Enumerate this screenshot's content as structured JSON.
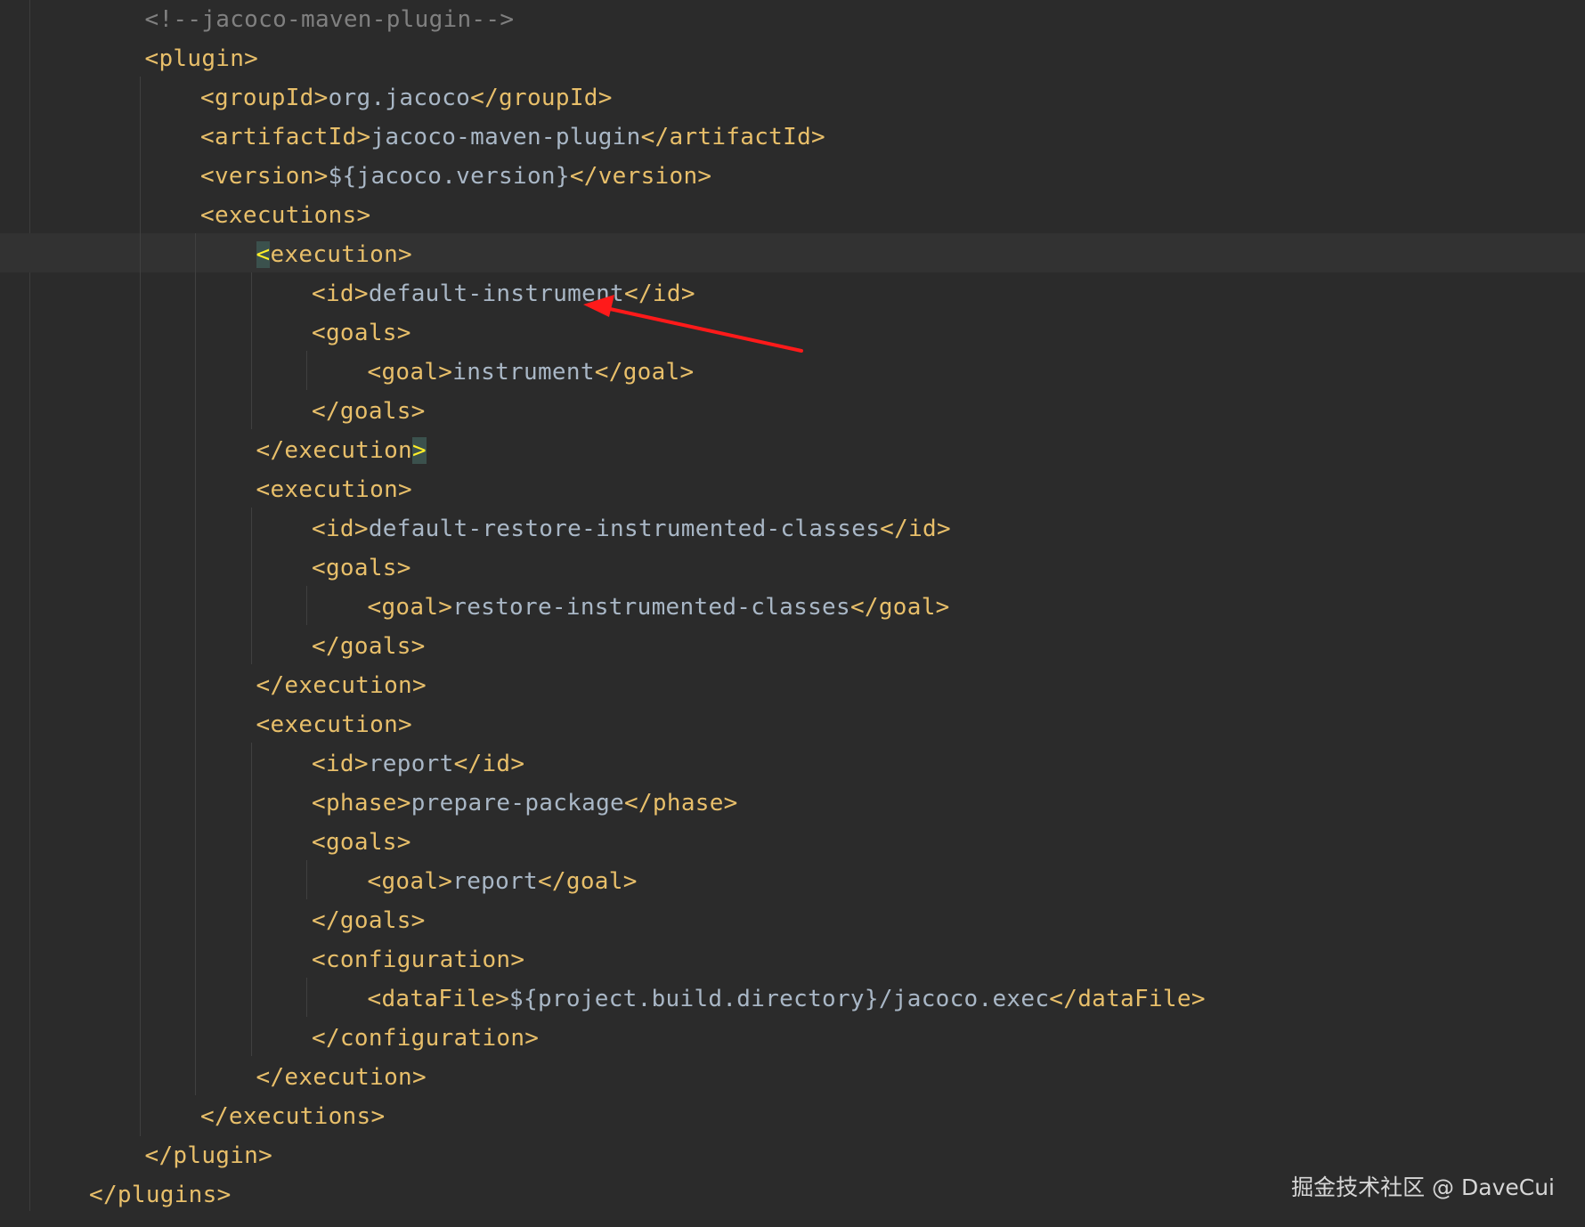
{
  "editor": {
    "lines": [
      {
        "indent": 3,
        "parts": [
          {
            "t": "<!--jacoco-maven-plugin-->",
            "c": "cmt"
          }
        ]
      },
      {
        "indent": 3,
        "parts": [
          {
            "t": "<plugin>",
            "c": "tag"
          }
        ]
      },
      {
        "indent": 4,
        "parts": [
          {
            "t": "<groupId>",
            "c": "tag"
          },
          {
            "t": "org.jacoco",
            "c": "txt"
          },
          {
            "t": "</groupId>",
            "c": "tag"
          }
        ]
      },
      {
        "indent": 4,
        "parts": [
          {
            "t": "<artifactId>",
            "c": "tag"
          },
          {
            "t": "jacoco-maven-plugin",
            "c": "txt"
          },
          {
            "t": "</artifactId>",
            "c": "tag"
          }
        ]
      },
      {
        "indent": 4,
        "parts": [
          {
            "t": "<version>",
            "c": "tag"
          },
          {
            "t": "${jacoco.version}",
            "c": "txt"
          },
          {
            "t": "</version>",
            "c": "tag"
          }
        ]
      },
      {
        "indent": 4,
        "parts": [
          {
            "t": "<executions>",
            "c": "tag"
          }
        ]
      },
      {
        "indent": 5,
        "current": true,
        "parts": [
          {
            "t": "<",
            "c": "bm"
          },
          {
            "t": "execution>",
            "c": "tag"
          }
        ]
      },
      {
        "indent": 6,
        "parts": [
          {
            "t": "<id>",
            "c": "tag"
          },
          {
            "t": "default-instrument",
            "c": "txt"
          },
          {
            "t": "</id>",
            "c": "tag"
          }
        ]
      },
      {
        "indent": 6,
        "parts": [
          {
            "t": "<goals>",
            "c": "tag"
          }
        ]
      },
      {
        "indent": 7,
        "parts": [
          {
            "t": "<goal>",
            "c": "tag"
          },
          {
            "t": "instrument",
            "c": "txt"
          },
          {
            "t": "</goal>",
            "c": "tag"
          }
        ]
      },
      {
        "indent": 6,
        "parts": [
          {
            "t": "</goals>",
            "c": "tag"
          }
        ]
      },
      {
        "indent": 5,
        "parts": [
          {
            "t": "</execution",
            "c": "tag"
          },
          {
            "t": ">",
            "c": "bm"
          }
        ]
      },
      {
        "indent": 5,
        "parts": [
          {
            "t": "<execution>",
            "c": "tag"
          }
        ]
      },
      {
        "indent": 6,
        "parts": [
          {
            "t": "<id>",
            "c": "tag"
          },
          {
            "t": "default-restore-instrumented-classes",
            "c": "txt"
          },
          {
            "t": "</id>",
            "c": "tag"
          }
        ]
      },
      {
        "indent": 6,
        "parts": [
          {
            "t": "<goals>",
            "c": "tag"
          }
        ]
      },
      {
        "indent": 7,
        "parts": [
          {
            "t": "<goal>",
            "c": "tag"
          },
          {
            "t": "restore-instrumented-classes",
            "c": "txt"
          },
          {
            "t": "</goal>",
            "c": "tag"
          }
        ]
      },
      {
        "indent": 6,
        "parts": [
          {
            "t": "</goals>",
            "c": "tag"
          }
        ]
      },
      {
        "indent": 5,
        "parts": [
          {
            "t": "</execution>",
            "c": "tag"
          }
        ]
      },
      {
        "indent": 5,
        "parts": [
          {
            "t": "<execution>",
            "c": "tag"
          }
        ]
      },
      {
        "indent": 6,
        "parts": [
          {
            "t": "<id>",
            "c": "tag"
          },
          {
            "t": "report",
            "c": "txt"
          },
          {
            "t": "</id>",
            "c": "tag"
          }
        ]
      },
      {
        "indent": 6,
        "parts": [
          {
            "t": "<phase>",
            "c": "tag"
          },
          {
            "t": "prepare-package",
            "c": "txt"
          },
          {
            "t": "</phase>",
            "c": "tag"
          }
        ]
      },
      {
        "indent": 6,
        "parts": [
          {
            "t": "<goals>",
            "c": "tag"
          }
        ]
      },
      {
        "indent": 7,
        "parts": [
          {
            "t": "<goal>",
            "c": "tag"
          },
          {
            "t": "report",
            "c": "txt"
          },
          {
            "t": "</goal>",
            "c": "tag"
          }
        ]
      },
      {
        "indent": 6,
        "parts": [
          {
            "t": "</goals>",
            "c": "tag"
          }
        ]
      },
      {
        "indent": 6,
        "parts": [
          {
            "t": "<configuration>",
            "c": "tag"
          }
        ]
      },
      {
        "indent": 7,
        "parts": [
          {
            "t": "<dataFile>",
            "c": "tag"
          },
          {
            "t": "${project.build.directory}/jacoco.exec",
            "c": "txt"
          },
          {
            "t": "</dataFile>",
            "c": "tag"
          }
        ]
      },
      {
        "indent": 6,
        "parts": [
          {
            "t": "</configuration>",
            "c": "tag"
          }
        ]
      },
      {
        "indent": 5,
        "parts": [
          {
            "t": "</execution>",
            "c": "tag"
          }
        ]
      },
      {
        "indent": 4,
        "parts": [
          {
            "t": "</executions>",
            "c": "tag"
          }
        ]
      },
      {
        "indent": 3,
        "parts": [
          {
            "t": "</plugin>",
            "c": "tag"
          }
        ]
      },
      {
        "indent": 2,
        "parts": [
          {
            "t": "</plugins>",
            "c": "tag"
          }
        ]
      }
    ]
  },
  "colors": {
    "background": "#2b2b2b",
    "tag": "#e8bf6a",
    "text": "#a9b7c6",
    "comment": "#808080",
    "arrow": "#ff1a1a"
  },
  "watermark": {
    "text": "掘金技术社区 @ DaveCui"
  },
  "annotation": {
    "icon": "red-arrow-icon"
  }
}
